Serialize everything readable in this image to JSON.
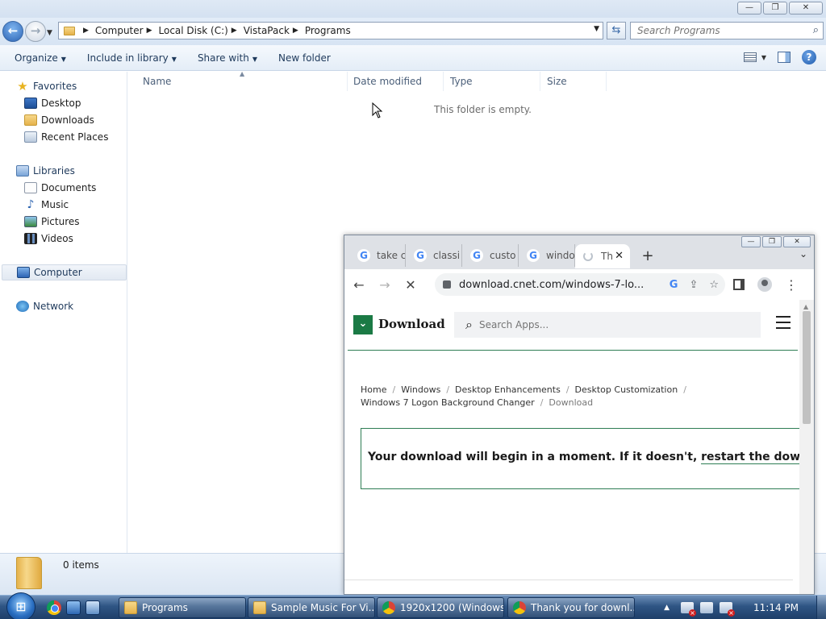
{
  "explorer": {
    "window_buttons": {
      "minimize": "—",
      "maximize": "❐",
      "close": "✕"
    },
    "breadcrumb": [
      "Computer",
      "Local Disk (C:)",
      "VistaPack",
      "Programs"
    ],
    "search_placeholder": "Search Programs",
    "toolbar": {
      "organize": "Organize",
      "include_in_library": "Include in library",
      "share_with": "Share with",
      "new_folder": "New folder"
    },
    "nav": {
      "favorites": "Favorites",
      "favorites_items": [
        "Desktop",
        "Downloads",
        "Recent Places"
      ],
      "libraries": "Libraries",
      "libraries_items": [
        "Documents",
        "Music",
        "Pictures",
        "Videos"
      ],
      "computer": "Computer",
      "network": "Network"
    },
    "columns": [
      "Name",
      "Date modified",
      "Type",
      "Size"
    ],
    "empty_message": "This folder is empty.",
    "status": "0 items"
  },
  "chrome": {
    "tabs": [
      "take c",
      "classi",
      "custo",
      "windo",
      "Th"
    ],
    "url": "download.cnet.com/windows-7-lo...",
    "site": {
      "logo_text": "Download",
      "search_placeholder": "Search Apps...",
      "breadcrumbs": [
        "Home",
        "Windows",
        "Desktop Enhancements",
        "Desktop Customization",
        "Windows 7 Logon Background Changer",
        "Download"
      ],
      "notice_text": "Your download will begin in a moment. If it doesn't,",
      "notice_link": "restart the download."
    }
  },
  "taskbar": {
    "buttons": [
      "Programs",
      "Sample Music For Vi...",
      "1920x1200 (Windows...",
      "Thank you for downl..."
    ],
    "clock": "11:14 PM"
  }
}
